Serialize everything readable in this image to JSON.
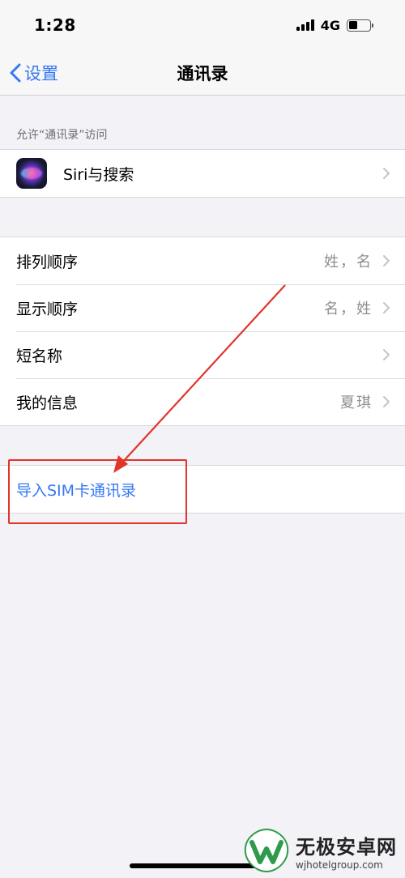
{
  "status": {
    "time": "1:28",
    "network": "4G"
  },
  "nav": {
    "back_label": "设置",
    "title": "通讯录"
  },
  "section_header": "允许“通讯录”访问",
  "siri_row": {
    "label": "Siri与搜索"
  },
  "settings_rows": [
    {
      "label": "排列顺序",
      "value": "姓，名"
    },
    {
      "label": "显示顺序",
      "value": "名，姓"
    },
    {
      "label": "短名称",
      "value": ""
    },
    {
      "label": "我的信息",
      "value": "夏琪"
    }
  ],
  "import_sim": {
    "label": "导入SIM卡通讯录"
  },
  "watermark": {
    "title": "无极安卓网",
    "url": "wjhotelgroup.com"
  },
  "colors": {
    "accent": "#3478f6",
    "annotation": "#e0352b",
    "background": "#f2f2f7"
  }
}
